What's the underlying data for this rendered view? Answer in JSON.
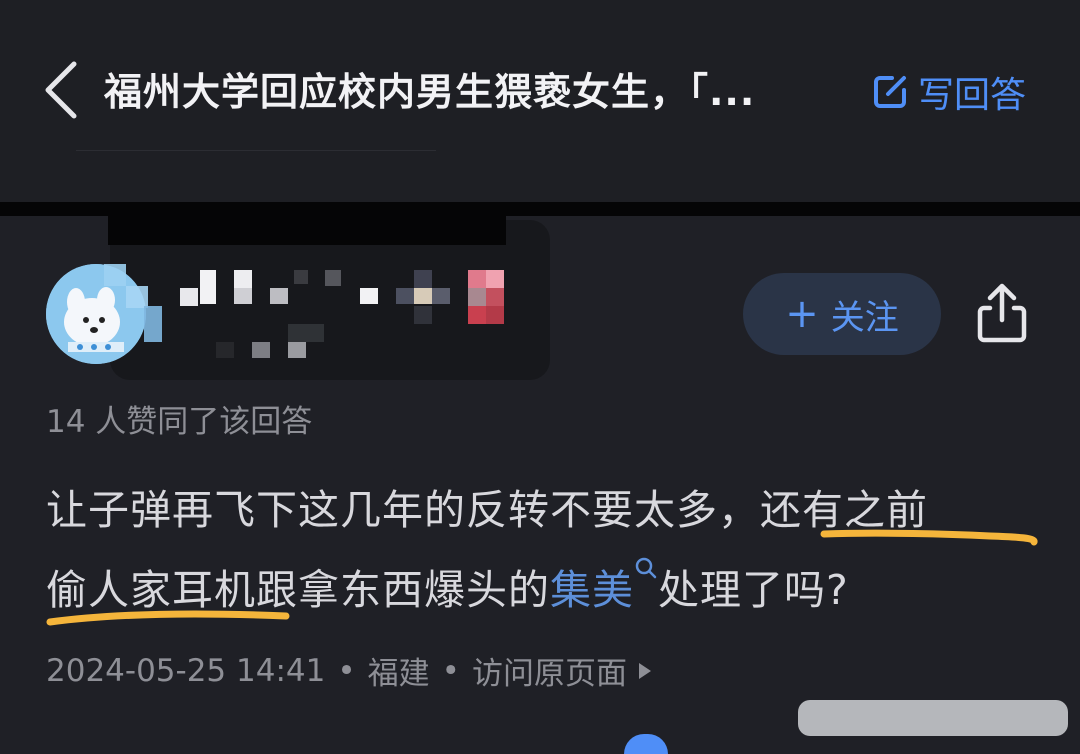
{
  "header": {
    "title": "福州大学回应校内男生猥亵女生，「...",
    "write_answer_label": "写回答",
    "accent_color": "#4f8ef7"
  },
  "author": {
    "follow_label": "关注",
    "follow_prefix": "+"
  },
  "answer": {
    "likes_text": "14 人赞同了该回答",
    "line1_plain": "让子弹再飞下这几年的反转不要太多，",
    "line1_highlight": "还有之前",
    "line2_highlight": "偷人家耳机",
    "line2_mid": "跟拿东西爆头的",
    "line2_link": "集美",
    "line2_end": "处理了吗?",
    "highlight_color": "#f5b53b",
    "link_color": "#5d8fd9"
  },
  "meta": {
    "date": "2024-05-25 14:41",
    "sep1": "•",
    "location": "福建",
    "sep2": "•",
    "view_original": "访问原页面"
  },
  "icons": {
    "back": "chevron-left-icon",
    "write": "edit-icon",
    "share": "share-icon",
    "search": "search-icon"
  }
}
